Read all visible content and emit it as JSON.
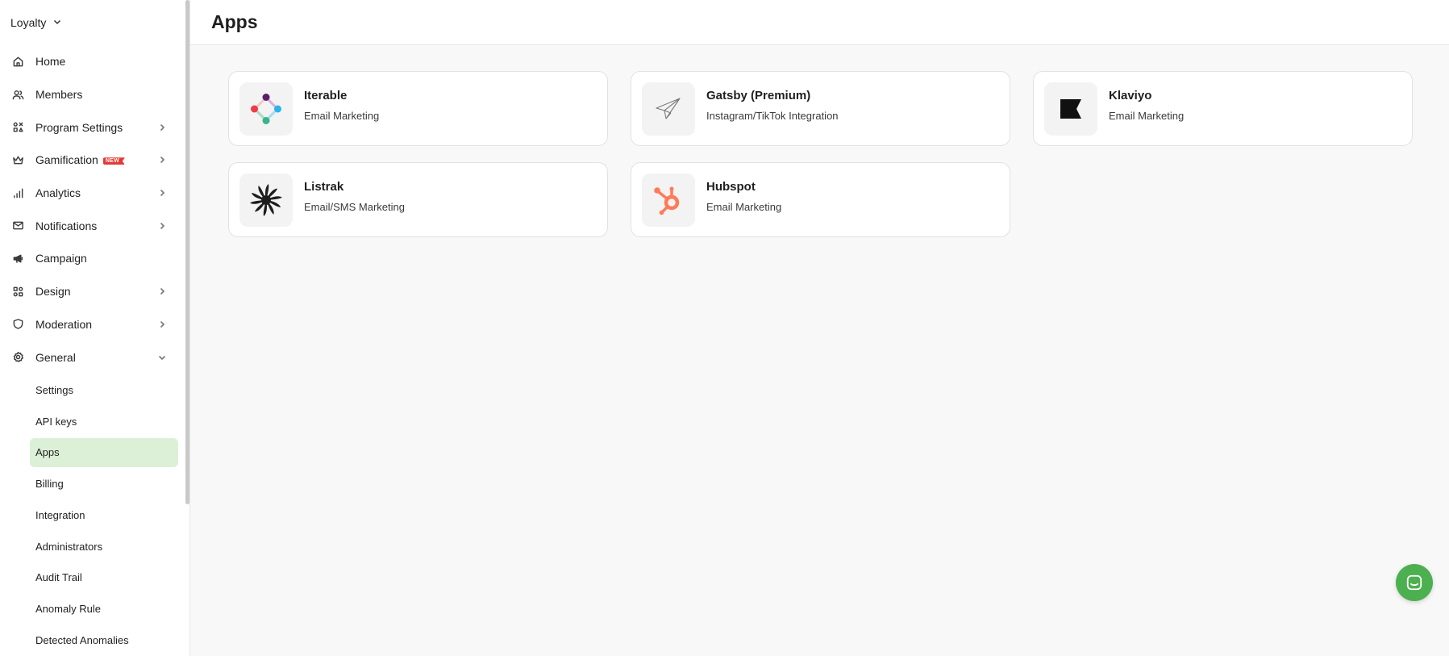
{
  "sidebar": {
    "workspace": "Loyalty",
    "nav": [
      {
        "label": "Home"
      },
      {
        "label": "Members"
      },
      {
        "label": "Program Settings"
      },
      {
        "label": "Gamification",
        "badge": "NEW"
      },
      {
        "label": "Analytics"
      },
      {
        "label": "Notifications"
      },
      {
        "label": "Campaign"
      },
      {
        "label": "Design"
      },
      {
        "label": "Moderation"
      },
      {
        "label": "General"
      }
    ],
    "general_sub": [
      {
        "label": "Settings"
      },
      {
        "label": "API keys"
      },
      {
        "label": "Apps"
      },
      {
        "label": "Billing"
      },
      {
        "label": "Integration"
      },
      {
        "label": "Administrators"
      },
      {
        "label": "Audit Trail"
      },
      {
        "label": "Anomaly Rule"
      },
      {
        "label": "Detected Anomalies"
      }
    ],
    "active_sub": "Apps",
    "active_color": "#dcf0d8"
  },
  "header": {
    "title": "Apps"
  },
  "apps": [
    {
      "name": "Iterable",
      "category": "Email Marketing",
      "icon": "iterable-logo"
    },
    {
      "name": "Gatsby (Premium)",
      "category": "Instagram/TikTok Integration",
      "icon": "paper-plane-icon"
    },
    {
      "name": "Klaviyo",
      "category": "Email Marketing",
      "icon": "klaviyo-flag-logo"
    },
    {
      "name": "Listrak",
      "category": "Email/SMS Marketing",
      "icon": "listrak-pinwheel-logo"
    },
    {
      "name": "Hubspot",
      "category": "Email Marketing",
      "icon": "hubspot-sprocket-logo"
    }
  ],
  "colors": {
    "chat_button": "#4caf50",
    "hubspot": "#ff7a59",
    "badge": "#e53935"
  }
}
